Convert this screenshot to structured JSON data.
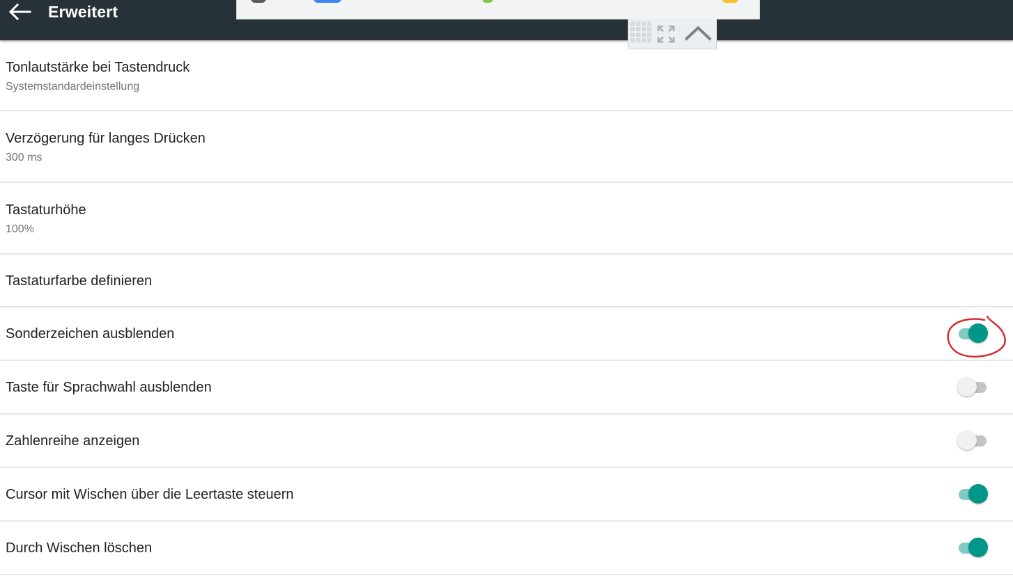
{
  "appbar": {
    "title": "Erweitert",
    "back_icon": "arrow-left-icon",
    "background": "#263238"
  },
  "keyboard_toolbar": {
    "icons": [
      "keyboard-grid-icon",
      "fullscreen-icon",
      "chevron-up-icon"
    ]
  },
  "settings": [
    {
      "title": "Tonlautstärke bei Tastendruck",
      "summary": "Systemstandardeinstellung"
    },
    {
      "title": "Verzögerung für langes Drücken",
      "summary": "300 ms"
    },
    {
      "title": "Tastaturhöhe",
      "summary": "100%"
    },
    {
      "title": "Tastaturfarbe definieren"
    },
    {
      "title": "Sonderzeichen ausblenden",
      "switch_on": true
    },
    {
      "title": "Taste für Sprachwahl ausblenden",
      "switch_on": false
    },
    {
      "title": "Zahlenreihe anzeigen",
      "switch_on": false
    },
    {
      "title": "Cursor mit Wischen über die Leertaste steuern",
      "switch_on": true
    },
    {
      "title": "Durch Wischen löschen",
      "switch_on": true
    }
  ],
  "colors": {
    "accent": "#009688",
    "accent_track": "#80cbc4",
    "annotation": "#d32f2f"
  }
}
